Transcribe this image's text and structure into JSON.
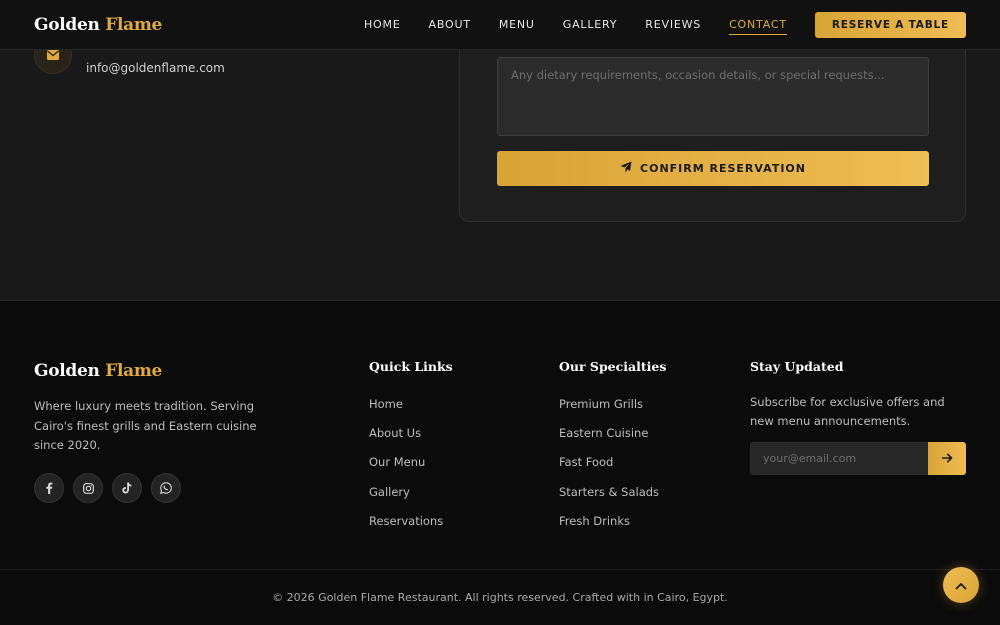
{
  "colors": {
    "accent": "#e0aa3e",
    "background": "#161616",
    "footer": "#0b0b0b"
  },
  "nav": {
    "brand_main": "Golden",
    "brand_accent": "Flame",
    "links": [
      "HOME",
      "ABOUT",
      "MENU",
      "GALLERY",
      "REVIEWS",
      "CONTACT"
    ],
    "active": "CONTACT",
    "reserve_label": "RESERVE A TABLE"
  },
  "contact": {
    "email_icon": "envelope-icon",
    "email": "info@goldenflame.com",
    "notes_placeholder": "Any dietary requirements, occasion details, or special requests...",
    "confirm_icon": "paper-plane-icon",
    "confirm_label": "CONFIRM RESERVATION"
  },
  "footer": {
    "brand_main": "Golden",
    "brand_accent": "Flame",
    "about": "Where luxury meets tradition. Serving Cairo's finest grills and Eastern cuisine since 2020.",
    "socials": [
      "facebook-icon",
      "instagram-icon",
      "tiktok-icon",
      "whatsapp-icon"
    ],
    "quick_links": {
      "title": "Quick Links",
      "items": [
        "Home",
        "About Us",
        "Our Menu",
        "Gallery",
        "Reservations"
      ]
    },
    "specialties": {
      "title": "Our Specialties",
      "items": [
        "Premium Grills",
        "Eastern Cuisine",
        "Fast Food",
        "Starters & Salads",
        "Fresh Drinks"
      ]
    },
    "newsletter": {
      "title": "Stay Updated",
      "text": "Subscribe for exclusive offers and new menu announcements.",
      "placeholder": "your@email.com",
      "submit_icon": "arrow-right-icon"
    },
    "copyright": "© 2026 Golden Flame Restaurant. All rights reserved. Crafted with in Cairo, Egypt."
  },
  "back_to_top_icon": "chevron-up-icon"
}
